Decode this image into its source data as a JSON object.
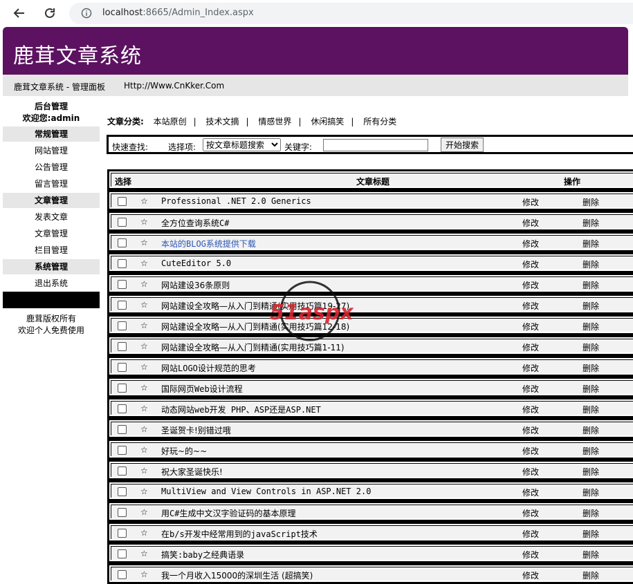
{
  "browser": {
    "url_host": "localhost",
    "url_rest": ":8665/Admin_Index.aspx"
  },
  "header": {
    "title": "鹿茸文章系统",
    "sub_title": "鹿茸文章系统 - 管理面板",
    "sub_link": "Http://Www.CnKker.Com"
  },
  "sidebar": {
    "admin_title": "后台管理",
    "welcome": "欢迎您:admin",
    "groups": [
      {
        "label": "常规管理"
      },
      {
        "label": "网站管理"
      },
      {
        "label": "公告管理"
      },
      {
        "label": "留言管理"
      },
      {
        "label": "文章管理"
      },
      {
        "label": "发表文章"
      },
      {
        "label": "文章管理"
      },
      {
        "label": "栏目管理"
      },
      {
        "label": "系统管理"
      },
      {
        "label": "退出系统"
      }
    ],
    "footer_line1": "鹿茸版权所有",
    "footer_line2": "欢迎个人免费使用"
  },
  "category": {
    "label": "文章分类:",
    "items": [
      "本站原创",
      "技术文摘",
      "情感世界",
      "休闲搞笑",
      "所有分类"
    ],
    "separator": "|"
  },
  "search": {
    "quick_label": "快速查找:",
    "option_label": "选择项:",
    "option_value": "按文章标题搜索",
    "keyword_label": "关键字:",
    "keyword_value": "",
    "button": "开始搜索"
  },
  "table": {
    "headers": {
      "select": "选择",
      "title": "文章标题",
      "action": "操作"
    },
    "edit_label": "修改",
    "delete_label": "删除",
    "star": "☆",
    "rows": [
      {
        "title": "Professional .NET 2.0 Generics"
      },
      {
        "title": "全方位查询系统C#"
      },
      {
        "title": "本站的BLOG系统提供下载"
      },
      {
        "title": "CuteEditor 5.0"
      },
      {
        "title": "网站建设36条原则"
      },
      {
        "title": "网站建设全攻略—从入门到精通(实用技巧篇19-27)"
      },
      {
        "title": "网站建设全攻略—从入门到精通(实用技巧篇12-18)"
      },
      {
        "title": "网站建设全攻略—从入门到精通(实用技巧篇1-11)"
      },
      {
        "title": "网站LOGO设计规范的思考"
      },
      {
        "title": "国际网页Web设计流程"
      },
      {
        "title": "动态网站web开发 PHP、ASP还是ASP.NET"
      },
      {
        "title": "圣诞贺卡!别错过哦"
      },
      {
        "title": "好玩~的~~"
      },
      {
        "title": "祝大家圣诞快乐!"
      },
      {
        "title": "MultiView and View Controls in ASP.NET 2.0"
      },
      {
        "title": "用C#生成中文汉字验证码的基本原理"
      },
      {
        "title": "在b/s开发中经常用到的javaScript技术"
      },
      {
        "title": "搞笑:baby之经典语录"
      },
      {
        "title": "我一个月收入15000的深圳生活 (超搞笑)"
      }
    ]
  },
  "watermark": {
    "text": "51aspx"
  },
  "colors": {
    "header_bg": "#5c1261",
    "link_blue": "#2a55b5",
    "gray_bar": "#e6e6e6"
  }
}
